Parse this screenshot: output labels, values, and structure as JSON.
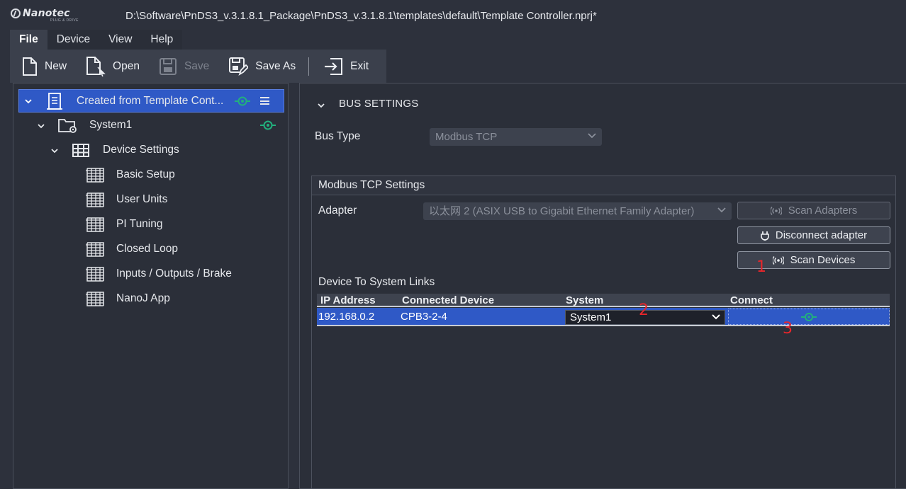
{
  "app": {
    "logo_text": "Nanotec",
    "logo_tagline": "PLUG & DRIVE",
    "window_title": "D:\\Software\\PnDS3_v.3.1.8.1_Package\\PnDS3_v.3.1.8.1\\templates\\default\\Template Controller.nprj*"
  },
  "menu": {
    "file": "File",
    "device": "Device",
    "view": "View",
    "help": "Help"
  },
  "toolbar": {
    "new_label": "New",
    "open_label": "Open",
    "save_label": "Save",
    "save_as_label": "Save As",
    "exit_label": "Exit"
  },
  "tree": {
    "project": "Created from Template Cont...",
    "system": "System1",
    "device_settings": "Device Settings",
    "items": [
      {
        "label": "Basic Setup"
      },
      {
        "label": "User Units"
      },
      {
        "label": "PI Tuning"
      },
      {
        "label": "Closed Loop"
      },
      {
        "label": "Inputs / Outputs / Brake"
      },
      {
        "label": "NanoJ App"
      }
    ]
  },
  "bus": {
    "section_title": "BUS SETTINGS",
    "bus_type_label": "Bus Type",
    "bus_type_value": "Modbus TCP",
    "group_title": "Modbus TCP Settings",
    "adapter_label": "Adapter",
    "adapter_value": "以太网 2 (ASIX USB to Gigabit Ethernet Family Adapter)",
    "scan_adapters": "Scan Adapters",
    "disconnect_adapter": "Disconnect adapter",
    "scan_devices": "Scan Devices",
    "links_label": "Device To System Links"
  },
  "links_table": {
    "columns": [
      "IP Address",
      "Connected Device",
      "System",
      "Connect"
    ],
    "rows": [
      {
        "ip": "192.168.0.2",
        "device": "CPB3-2-4",
        "system": "System1"
      }
    ]
  },
  "annotations": {
    "a1": "1",
    "a2": "2",
    "a3": "3"
  },
  "colors": {
    "accent_blue": "#2f59c6",
    "connect_green": "#22b07d",
    "annotation_red": "#e8262b"
  },
  "icons": {
    "new": "new-file-icon",
    "open": "open-file-icon",
    "save": "save-icon",
    "save_as": "save-as-icon",
    "exit": "exit-icon",
    "connected": "connected-plug-icon",
    "menu": "hamburger-menu-icon"
  }
}
